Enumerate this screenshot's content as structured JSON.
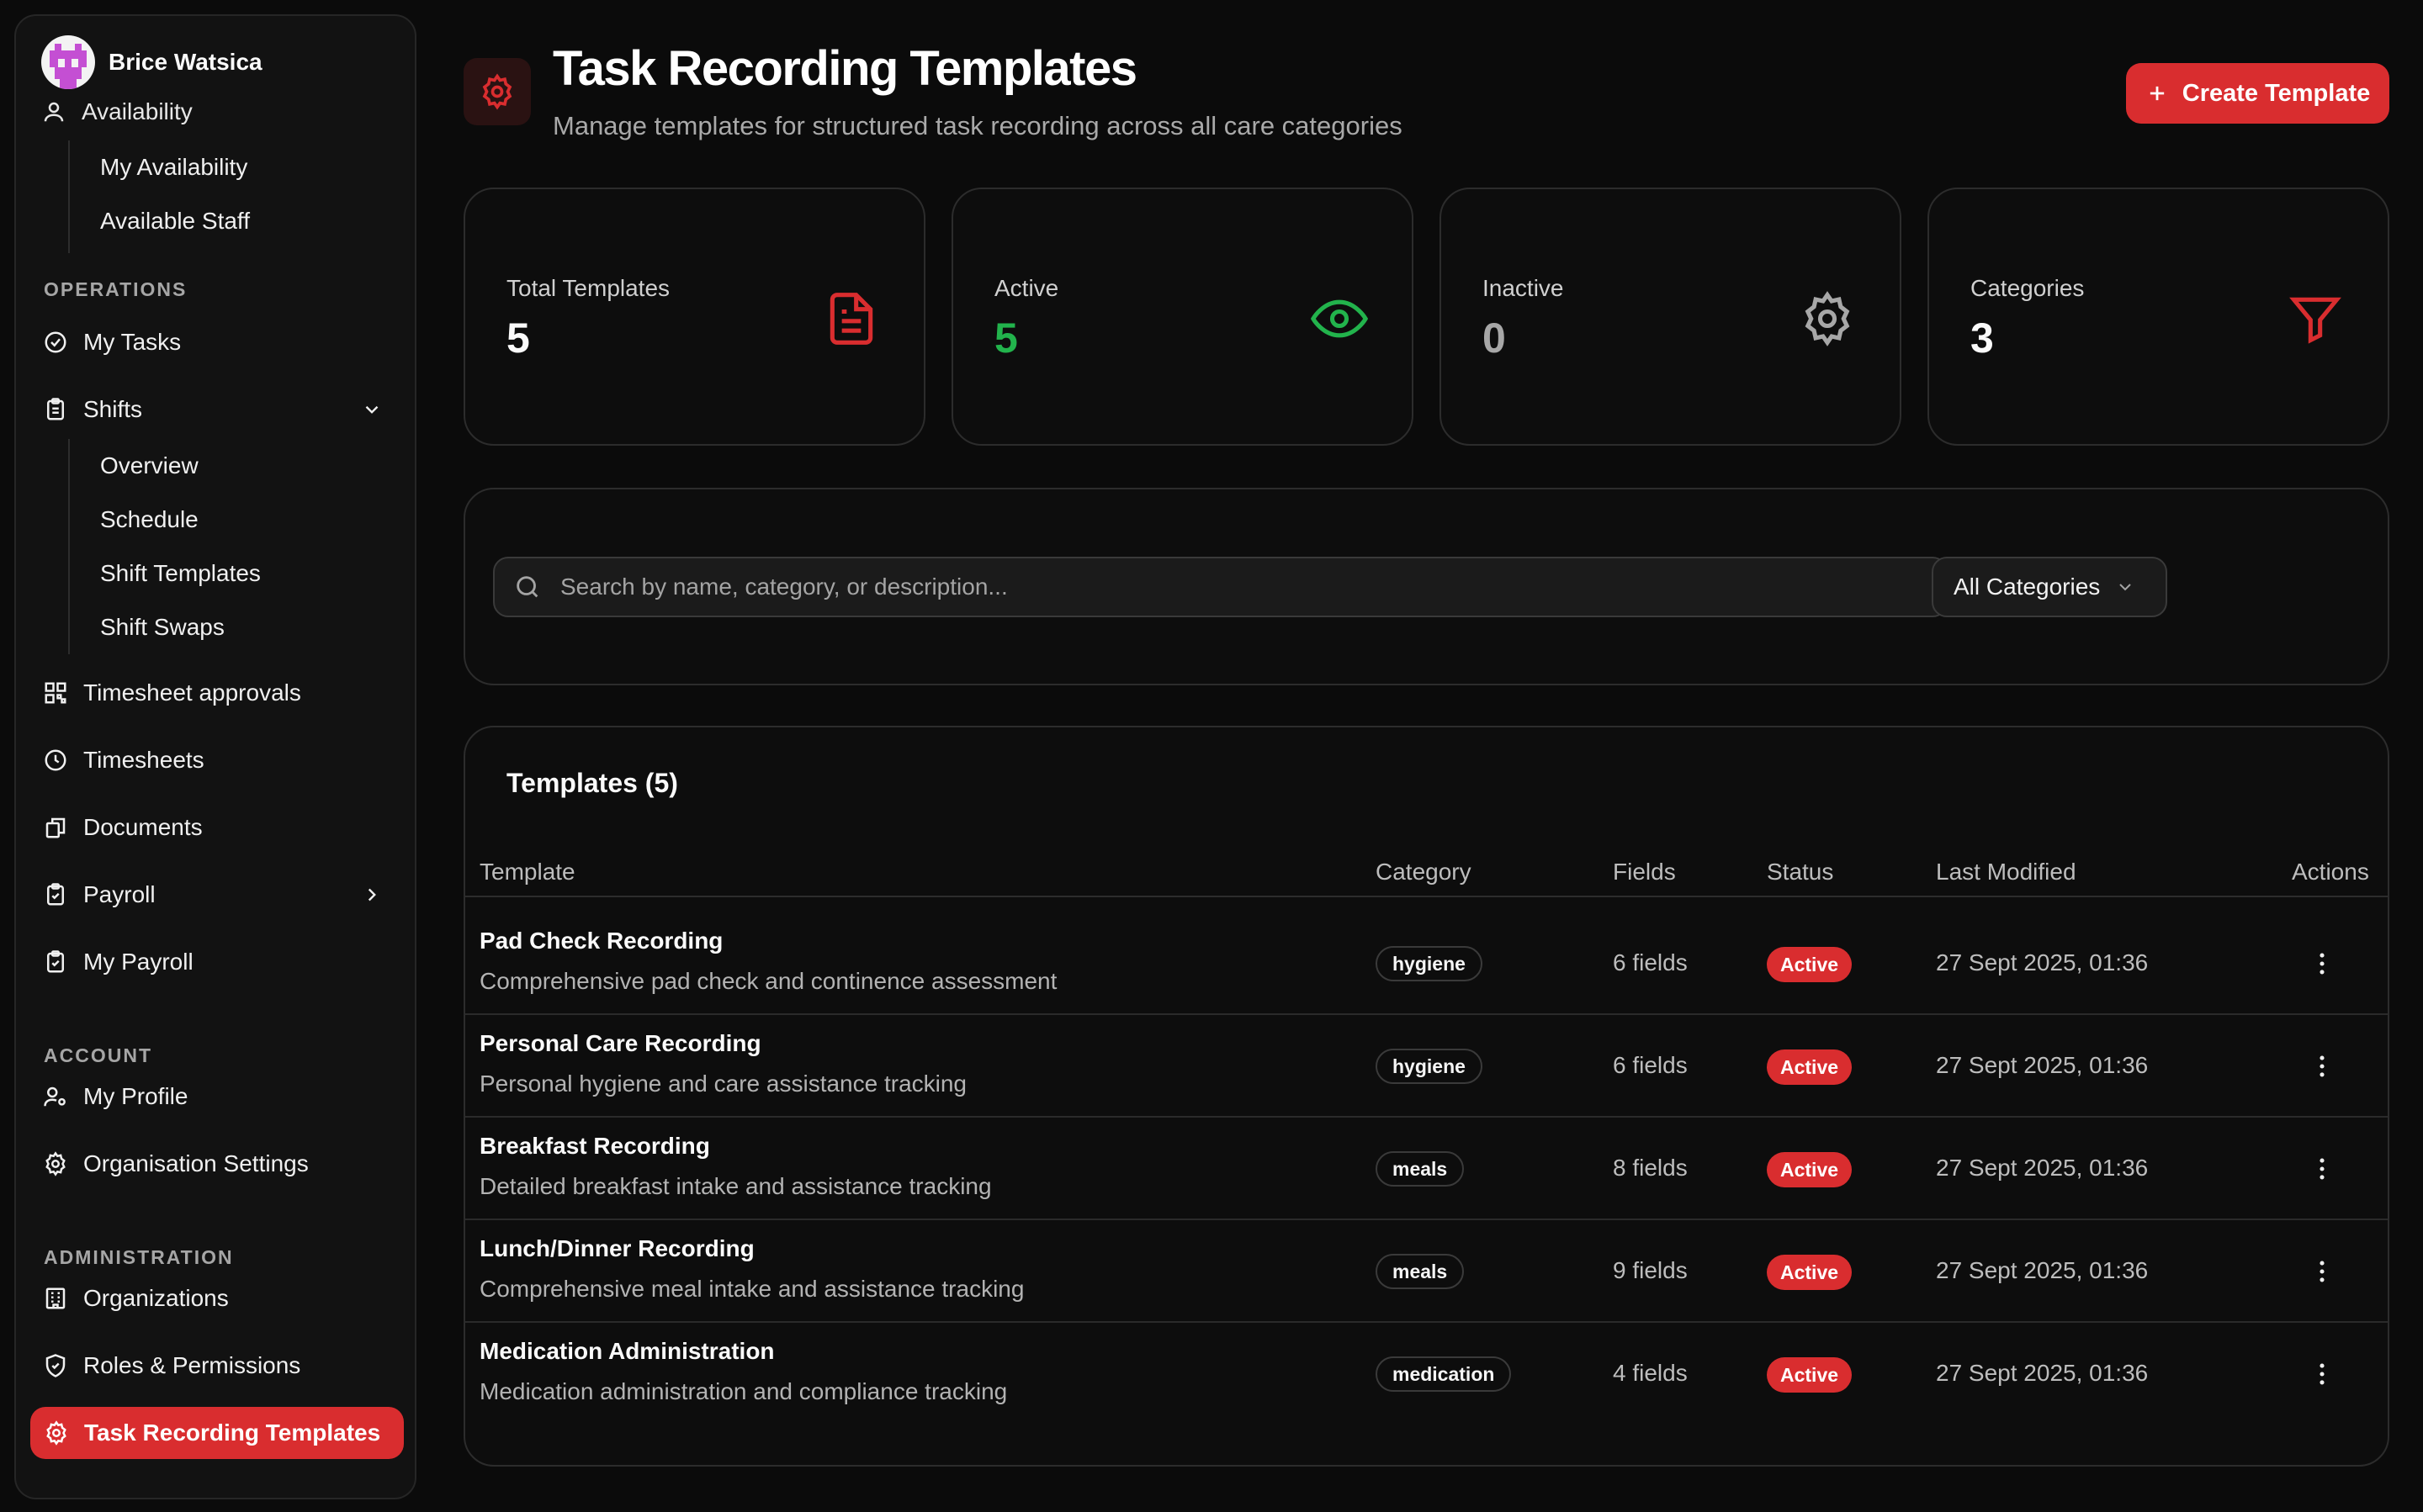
{
  "user": {
    "name": "Brice Watsica"
  },
  "sidebar": {
    "availability": {
      "label": "Availability",
      "items": [
        {
          "label": "My Availability"
        },
        {
          "label": "Available Staff"
        }
      ]
    },
    "operations": {
      "label": "OPERATIONS",
      "my_tasks": "My Tasks",
      "shifts": {
        "label": "Shifts",
        "items": [
          {
            "label": "Overview"
          },
          {
            "label": "Schedule"
          },
          {
            "label": "Shift Templates"
          },
          {
            "label": "Shift Swaps"
          }
        ]
      },
      "timesheet_approvals": "Timesheet approvals",
      "timesheets": "Timesheets",
      "documents": "Documents",
      "payroll": "Payroll",
      "my_payroll": "My Payroll"
    },
    "account": {
      "label": "ACCOUNT",
      "my_profile": "My Profile",
      "organisation_settings": "Organisation Settings"
    },
    "administration": {
      "label": "ADMINISTRATION",
      "organizations": "Organizations",
      "roles_permissions": "Roles & Permissions",
      "task_recording_templates": "Task Recording Templates"
    }
  },
  "header": {
    "title": "Task Recording Templates",
    "subtitle": "Manage templates for structured task recording across all care categories",
    "create_button": "Create Template"
  },
  "stats": [
    {
      "label": "Total Templates",
      "value": "5",
      "icon": "document-icon",
      "color": "#d92d2f"
    },
    {
      "label": "Active",
      "value": "5",
      "icon": "eye-icon",
      "color": "#22b34c"
    },
    {
      "label": "Inactive",
      "value": "0",
      "icon": "gear-icon",
      "color": "#a7a7a7"
    },
    {
      "label": "Categories",
      "value": "3",
      "icon": "filter-icon",
      "color": "#d92d2f"
    }
  ],
  "filters": {
    "search_placeholder": "Search by name, category, or description...",
    "category_select": "All Categories"
  },
  "table": {
    "title": "Templates (5)",
    "columns": [
      "Template",
      "Category",
      "Fields",
      "Status",
      "Last Modified",
      "Actions"
    ],
    "rows": [
      {
        "name": "Pad Check Recording",
        "description": "Comprehensive pad check and continence assessment",
        "category": "hygiene",
        "fields": "6 fields",
        "status": "Active",
        "modified": "27 Sept 2025, 01:36"
      },
      {
        "name": "Personal Care Recording",
        "description": "Personal hygiene and care assistance tracking",
        "category": "hygiene",
        "fields": "6 fields",
        "status": "Active",
        "modified": "27 Sept 2025, 01:36"
      },
      {
        "name": "Breakfast Recording",
        "description": "Detailed breakfast intake and assistance tracking",
        "category": "meals",
        "fields": "8 fields",
        "status": "Active",
        "modified": "27 Sept 2025, 01:36"
      },
      {
        "name": "Lunch/Dinner Recording",
        "description": "Comprehensive meal intake and assistance tracking",
        "category": "meals",
        "fields": "9 fields",
        "status": "Active",
        "modified": "27 Sept 2025, 01:36"
      },
      {
        "name": "Medication Administration",
        "description": "Medication administration and compliance tracking",
        "category": "medication",
        "fields": "4 fields",
        "status": "Active",
        "modified": "27 Sept 2025, 01:36"
      }
    ]
  },
  "colors": {
    "accent": "#d92d2f",
    "success": "#22b34c",
    "background": "#0b0b0b",
    "surface": "#121212"
  }
}
